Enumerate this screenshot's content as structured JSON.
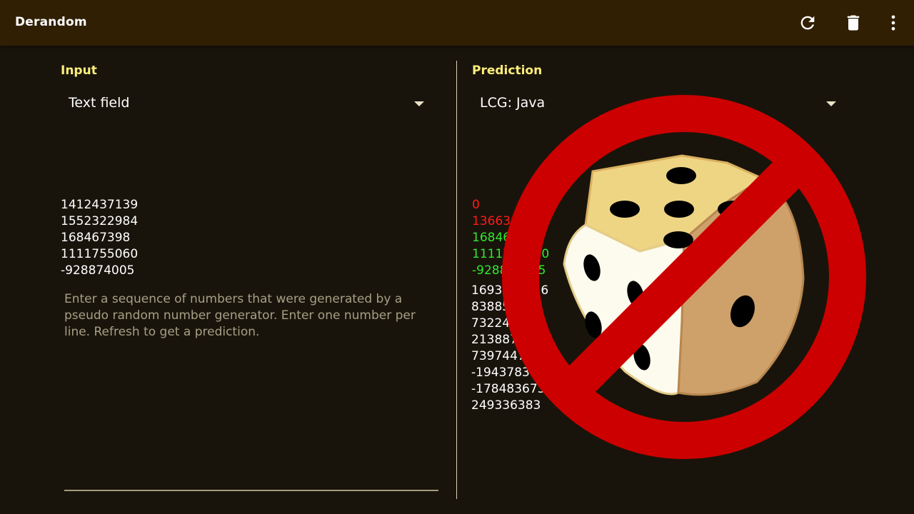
{
  "app": {
    "title": "Derandom"
  },
  "toolbar": {
    "refresh_icon": "refresh-icon",
    "delete_icon": "trash-icon",
    "menu_icon": "more-vert-icon"
  },
  "colors": {
    "appbar": "#311f03",
    "background": "#19140b",
    "label": "#fbee7c",
    "wrong": "#ff1a1a",
    "correct": "#30e830",
    "hint": "#a89f85",
    "badge_red": "#cc0000"
  },
  "input": {
    "label": "Input",
    "source_selected": "Text field",
    "numbers": [
      "1412437139",
      "1552322984",
      "168467398",
      "1111755060",
      "-928874005"
    ],
    "hint": "Enter a sequence of numbers that were generated by a pseudo random number generator. Enter one number per line. Refresh to get a prediction."
  },
  "prediction": {
    "label": "Prediction",
    "method_selected": "LCG: Java",
    "checked_numbers": [
      {
        "value": "0",
        "status": "wrong"
      },
      {
        "value": "1366300984",
        "status": "wrong"
      },
      {
        "value": "168467398",
        "status": "correct"
      },
      {
        "value": "1111755060",
        "status": "correct"
      },
      {
        "value": "-928874005",
        "status": "correct"
      }
    ],
    "next_numbers": [
      "1693142726",
      "838853948",
      "732241073",
      "2138872886",
      "739744796",
      "-1943783623",
      "-1784836734",
      "249336383"
    ]
  },
  "overlay": {
    "icon": "no-dice-icon"
  }
}
